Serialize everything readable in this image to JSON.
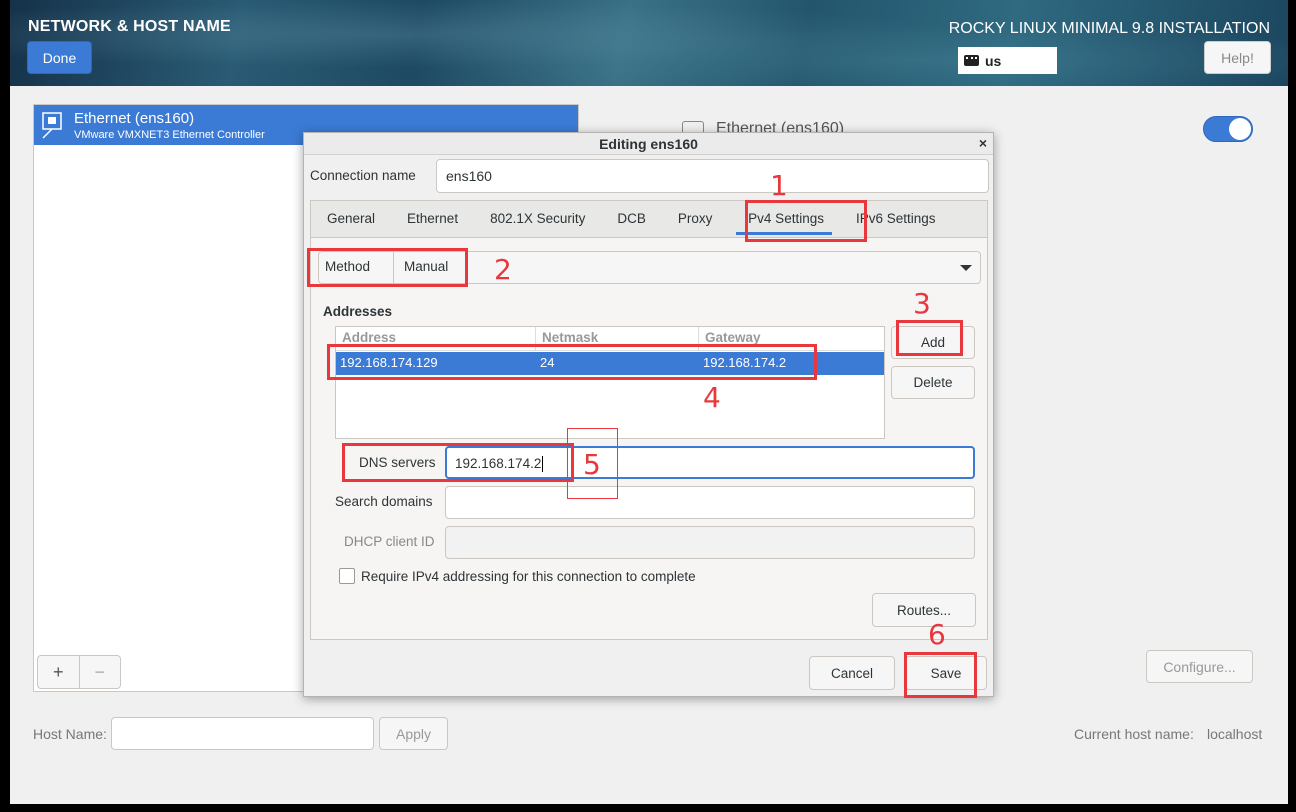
{
  "header": {
    "title": "NETWORK & HOST NAME",
    "done_label": "Done",
    "product": "ROCKY LINUX MINIMAL 9.8 INSTALLATION",
    "keyboard_layout": "us",
    "help_label": "Help!"
  },
  "device": {
    "name": "Ethernet (ens160)",
    "description": "VMware VMXNET3 Ethernet Controller",
    "detail_title": "Ethernet (ens160)",
    "add_label": "+",
    "remove_label": "−",
    "configure_label": "Configure..."
  },
  "hostname": {
    "label": "Host Name:",
    "value": "",
    "apply_label": "Apply",
    "current_label": "Current host name:",
    "current_value": "localhost"
  },
  "dialog": {
    "title": "Editing ens160",
    "close_glyph": "×",
    "connection_name_label": "Connection name",
    "connection_name_value": "ens160",
    "tabs": [
      {
        "label": "General"
      },
      {
        "label": "Ethernet"
      },
      {
        "label": "802.1X Security"
      },
      {
        "label": "DCB"
      },
      {
        "label": "Proxy"
      },
      {
        "label": "IPv4 Settings"
      },
      {
        "label": "IPv6 Settings"
      }
    ],
    "active_tab": "IPv4 Settings",
    "method_label": "Method",
    "method_value": "Manual",
    "addresses_heading": "Addresses",
    "address_columns": [
      "Address",
      "Netmask",
      "Gateway"
    ],
    "addresses": [
      {
        "address": "192.168.174.129",
        "netmask": "24",
        "gateway": "192.168.174.2"
      }
    ],
    "add_label": "Add",
    "delete_label": "Delete",
    "dns_label": "DNS servers",
    "dns_value": "192.168.174.2",
    "search_domains_label": "Search domains",
    "search_domains_value": "",
    "dhcp_client_id_label": "DHCP client ID",
    "dhcp_client_id_value": "",
    "require_ipv4_label": "Require IPv4 addressing for this connection to complete",
    "require_ipv4_checked": false,
    "routes_label": "Routes...",
    "cancel_label": "Cancel",
    "save_label": "Save"
  },
  "annotations": [
    "1",
    "2",
    "3",
    "4",
    "5",
    "6"
  ],
  "colors": {
    "accent": "#3b7bd5",
    "annotation": "#e8383d"
  }
}
